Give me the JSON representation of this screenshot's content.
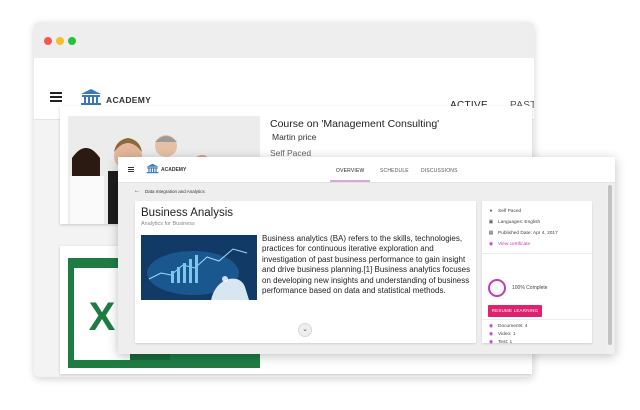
{
  "back_window": {
    "app_name": "ACADEMY",
    "tabs": [
      {
        "label": "ACTIVE",
        "active": true
      },
      {
        "label": "PAST",
        "active": false
      }
    ],
    "courses": [
      {
        "title": "Course on 'Management Consulting'",
        "author": "Martin price",
        "pace": "Self Paced",
        "thumbnail": "business-team-photo"
      },
      {
        "thumbnail": "excel-logo",
        "logo_letter": "X"
      }
    ]
  },
  "front_window": {
    "app_name": "ACADEMY",
    "tabs": [
      {
        "label": "OVERVIEW",
        "active": true
      },
      {
        "label": "SCHEDULE",
        "active": false
      },
      {
        "label": "DISCUSSIONS",
        "active": false
      }
    ],
    "breadcrumb": "Data Integration and Analytics",
    "course": {
      "title": "Business Analysis",
      "subtitle": "Analytics for Business",
      "description": "Business analytics (BA) refers to the skills, technologies, practices for continuous iterative exploration and investigation of past business performance to gain insight and drive business planning.[1] Business analytics focuses on developing new insights and understanding of business performance based on data and statistical methods."
    },
    "sidebar": {
      "details": [
        {
          "icon": "person-icon",
          "text": "Self Paced"
        },
        {
          "icon": "language-icon",
          "text": "Languages: English"
        },
        {
          "icon": "calendar-icon",
          "text": "Published Date: Apr 4, 2017"
        },
        {
          "icon": "certificate-icon",
          "text": "View certificate",
          "link": true
        }
      ],
      "progress": {
        "percent": 100,
        "label": "100% Complete"
      },
      "resume_label": "RESUME LEARNING",
      "stats": [
        {
          "icon": "document-icon",
          "text": "Documents: 4"
        },
        {
          "icon": "video-icon",
          "text": "Video: 1"
        },
        {
          "icon": "test-icon",
          "text": "Test: 1"
        }
      ]
    }
  },
  "colors": {
    "accent_pink": "#e0216e",
    "accent_purple": "#c23bb8",
    "tab_underline": "#d8a8d8",
    "excel_green": "#1e7c43"
  }
}
